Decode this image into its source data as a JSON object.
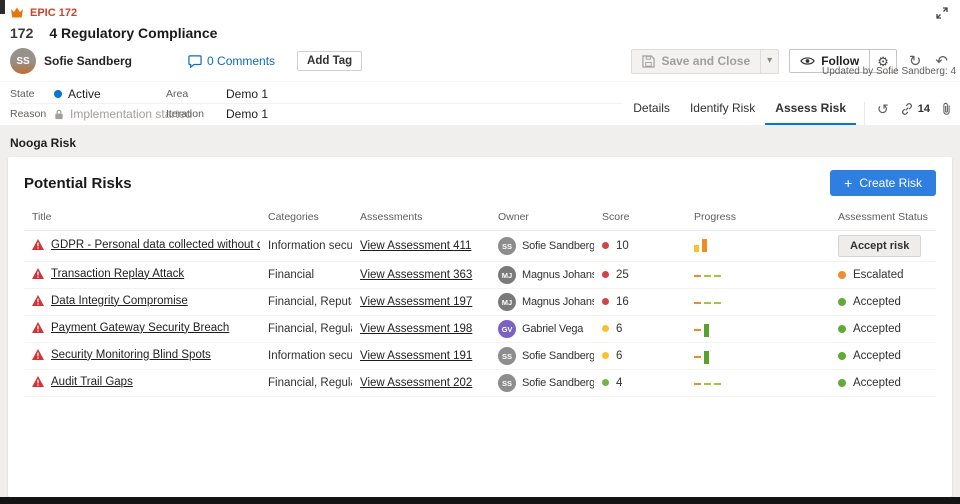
{
  "colors": {
    "accent": "#0078d4",
    "epic": "#c7452c",
    "create_button": "#2f7fe0"
  },
  "icons": {
    "gear": "⚙",
    "refresh": "↻",
    "undo": "↶",
    "history": "↺",
    "plus": "+",
    "chevron_down": "▾"
  },
  "header": {
    "epic_label": "EPIC 172",
    "item_id": "172",
    "title": "4 Regulatory Compliance",
    "owner": "Sofie Sandberg",
    "owner_initials": "SS",
    "comments_label": "0 Comments",
    "add_tag_label": "Add Tag",
    "save_button_label": "Save and Close",
    "follow_label": "Follow",
    "updated_text": "Updated by Sofie Sandberg: 4"
  },
  "fields": {
    "state_label": "State",
    "state_value": "Active",
    "state_color": "#0078d4",
    "reason_label": "Reason",
    "reason_value": "Implementation started",
    "area_label": "Area",
    "area_value": "Demo 1",
    "iteration_label": "Iteration",
    "iteration_value": "Demo 1"
  },
  "tabs": {
    "items": [
      {
        "label": "Details",
        "active": false
      },
      {
        "label": "Identify Risk",
        "active": false
      },
      {
        "label": "Assess Risk",
        "active": true
      }
    ],
    "links_count": "14"
  },
  "section_title": "Nooga Risk",
  "risks": {
    "heading": "Potential Risks",
    "create_label": "Create Risk",
    "columns": [
      "Title",
      "Categories",
      "Assessments",
      "Owner",
      "Score",
      "Progress",
      "Assessment Status"
    ],
    "rows": [
      {
        "title": "GDPR - Personal data collected without consent",
        "categories": "Information security...",
        "assessment": "View Assessment 411",
        "owner": "Sofie Sandberg",
        "owner_initials": "SS",
        "owner_color": "#8d8d8d",
        "score": "10",
        "score_color": "#cf4444",
        "progress": [
          {
            "t": "bar",
            "c": "#f5c42c",
            "h": 7
          },
          {
            "t": "bar",
            "c": "#ef8d22",
            "h": 13
          }
        ],
        "status": {
          "kind": "button",
          "label": "Accept risk"
        }
      },
      {
        "title": "Transaction Replay Attack",
        "categories": "Financial",
        "assessment": "View Assessment 363",
        "owner": "Magnus Johansson",
        "owner_initials": "MJ",
        "owner_color": "#7a7a7a",
        "score": "25",
        "score_color": "#cf4444",
        "progress": [
          {
            "t": "dash",
            "c": "#ef8d22"
          },
          {
            "t": "dash",
            "c": "#a0c83c"
          },
          {
            "t": "dash",
            "c": "#a0c83c"
          }
        ],
        "status": {
          "kind": "dot",
          "label": "Escalated",
          "color": "#ef8c32"
        }
      },
      {
        "title": "Data Integrity Compromise",
        "categories": "Financial, Reputatio...",
        "assessment": "View Assessment 197",
        "owner": "Magnus Johansson",
        "owner_initials": "MJ",
        "owner_color": "#7a7a7a",
        "score": "16",
        "score_color": "#cf4444",
        "progress": [
          {
            "t": "dash",
            "c": "#ef8d22"
          },
          {
            "t": "dash",
            "c": "#a0c83c"
          },
          {
            "t": "dash",
            "c": "#a0c83c"
          }
        ],
        "status": {
          "kind": "dot",
          "label": "Accepted",
          "color": "#62aa38"
        }
      },
      {
        "title": "Payment Gateway Security Breach",
        "categories": "Financial, Regulatory",
        "assessment": "View Assessment 198",
        "owner": "Gabriel Vega",
        "owner_initials": "GV",
        "owner_color": "#7b61c4",
        "score": "6",
        "score_color": "#f5c42c",
        "progress": [
          {
            "t": "dash",
            "c": "#ef8d22"
          },
          {
            "t": "bar",
            "c": "#5aa02c",
            "h": 13
          }
        ],
        "status": {
          "kind": "dot",
          "label": "Accepted",
          "color": "#62aa38"
        }
      },
      {
        "title": "Security Monitoring Blind Spots",
        "categories": "Information security",
        "assessment": "View Assessment 191",
        "owner": "Sofie Sandberg",
        "owner_initials": "SS",
        "owner_color": "#8d8d8d",
        "score": "6",
        "score_color": "#f5c42c",
        "progress": [
          {
            "t": "dash",
            "c": "#ef8d22"
          },
          {
            "t": "bar",
            "c": "#5aa02c",
            "h": 13
          }
        ],
        "status": {
          "kind": "dot",
          "label": "Accepted",
          "color": "#62aa38"
        }
      },
      {
        "title": "Audit Trail Gaps",
        "categories": "Financial, Regulatory",
        "assessment": "View Assessment 202",
        "owner": "Sofie Sandberg",
        "owner_initials": "SS",
        "owner_color": "#8d8d8d",
        "score": "4",
        "score_color": "#6fb83f",
        "progress": [
          {
            "t": "dash",
            "c": "#ef8d22"
          },
          {
            "t": "dash",
            "c": "#a0c83c"
          },
          {
            "t": "dash",
            "c": "#a0c83c"
          }
        ],
        "status": {
          "kind": "dot",
          "label": "Accepted",
          "color": "#62aa38"
        }
      }
    ]
  }
}
